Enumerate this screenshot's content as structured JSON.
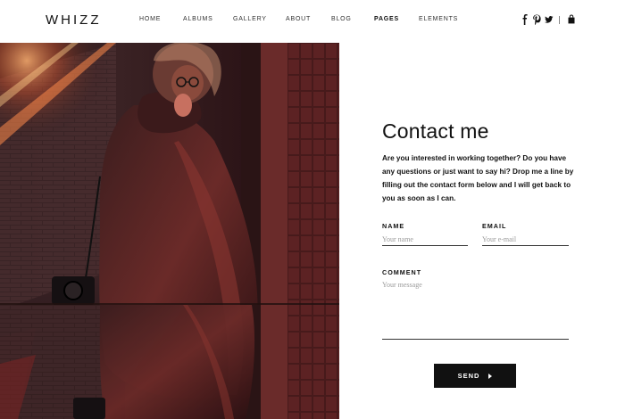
{
  "brand": {
    "logo": "WHIZZ"
  },
  "nav": {
    "items": [
      {
        "label": "HOME"
      },
      {
        "label": "ALBUMS"
      },
      {
        "label": "GALLERY"
      },
      {
        "label": "ABOUT"
      },
      {
        "label": "BLOG"
      },
      {
        "label": "PAGES"
      },
      {
        "label": "ELEMENTS"
      }
    ],
    "active": "PAGES"
  },
  "social": {
    "icons": [
      "facebook-icon",
      "pinterest-icon",
      "twitter-icon",
      "shopping-bag-icon"
    ],
    "glyphs": {
      "facebook": "f",
      "pinterest": "𝒑",
      "twitter": "t"
    }
  },
  "contact": {
    "title": "Contact me",
    "intro": "Are you interested in working together? Do you have any questions or just want to say hi? Drop me a line by filling out the contact form below and I will get back to you as soon as I can.",
    "name_label": "NAME",
    "name_placeholder": "Your name",
    "email_label": "EMAIL",
    "email_placeholder": "Your e-mail",
    "comment_label": "COMMENT",
    "comment_placeholder": "Your message",
    "send_label": "SEND"
  },
  "colors": {
    "text": "#111111",
    "button_bg": "#111111",
    "photo_accent": "#c23a2e"
  }
}
